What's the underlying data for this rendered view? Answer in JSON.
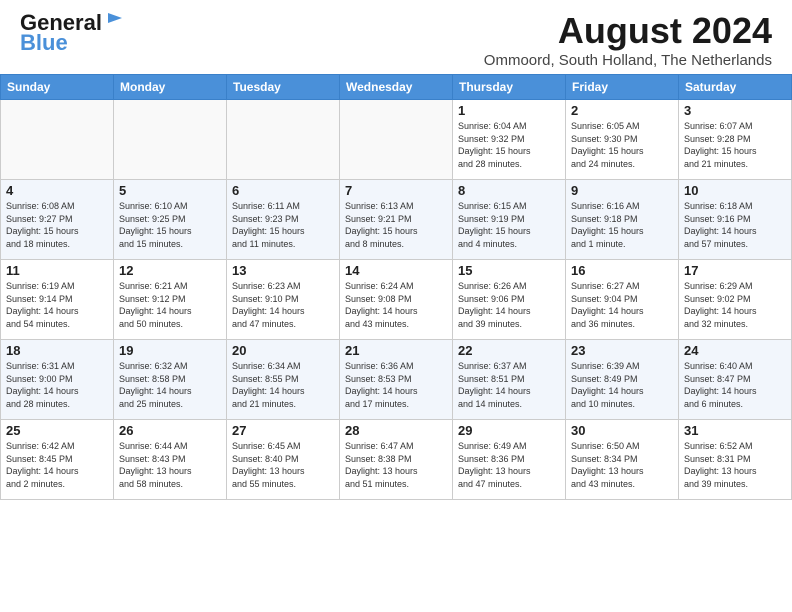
{
  "header": {
    "logo_general": "General",
    "logo_blue": "Blue",
    "month": "August 2024",
    "location": "Ommoord, South Holland, The Netherlands"
  },
  "weekdays": [
    "Sunday",
    "Monday",
    "Tuesday",
    "Wednesday",
    "Thursday",
    "Friday",
    "Saturday"
  ],
  "weeks": [
    [
      {
        "day": "",
        "info": ""
      },
      {
        "day": "",
        "info": ""
      },
      {
        "day": "",
        "info": ""
      },
      {
        "day": "",
        "info": ""
      },
      {
        "day": "1",
        "info": "Sunrise: 6:04 AM\nSunset: 9:32 PM\nDaylight: 15 hours\nand 28 minutes."
      },
      {
        "day": "2",
        "info": "Sunrise: 6:05 AM\nSunset: 9:30 PM\nDaylight: 15 hours\nand 24 minutes."
      },
      {
        "day": "3",
        "info": "Sunrise: 6:07 AM\nSunset: 9:28 PM\nDaylight: 15 hours\nand 21 minutes."
      }
    ],
    [
      {
        "day": "4",
        "info": "Sunrise: 6:08 AM\nSunset: 9:27 PM\nDaylight: 15 hours\nand 18 minutes."
      },
      {
        "day": "5",
        "info": "Sunrise: 6:10 AM\nSunset: 9:25 PM\nDaylight: 15 hours\nand 15 minutes."
      },
      {
        "day": "6",
        "info": "Sunrise: 6:11 AM\nSunset: 9:23 PM\nDaylight: 15 hours\nand 11 minutes."
      },
      {
        "day": "7",
        "info": "Sunrise: 6:13 AM\nSunset: 9:21 PM\nDaylight: 15 hours\nand 8 minutes."
      },
      {
        "day": "8",
        "info": "Sunrise: 6:15 AM\nSunset: 9:19 PM\nDaylight: 15 hours\nand 4 minutes."
      },
      {
        "day": "9",
        "info": "Sunrise: 6:16 AM\nSunset: 9:18 PM\nDaylight: 15 hours\nand 1 minute."
      },
      {
        "day": "10",
        "info": "Sunrise: 6:18 AM\nSunset: 9:16 PM\nDaylight: 14 hours\nand 57 minutes."
      }
    ],
    [
      {
        "day": "11",
        "info": "Sunrise: 6:19 AM\nSunset: 9:14 PM\nDaylight: 14 hours\nand 54 minutes."
      },
      {
        "day": "12",
        "info": "Sunrise: 6:21 AM\nSunset: 9:12 PM\nDaylight: 14 hours\nand 50 minutes."
      },
      {
        "day": "13",
        "info": "Sunrise: 6:23 AM\nSunset: 9:10 PM\nDaylight: 14 hours\nand 47 minutes."
      },
      {
        "day": "14",
        "info": "Sunrise: 6:24 AM\nSunset: 9:08 PM\nDaylight: 14 hours\nand 43 minutes."
      },
      {
        "day": "15",
        "info": "Sunrise: 6:26 AM\nSunset: 9:06 PM\nDaylight: 14 hours\nand 39 minutes."
      },
      {
        "day": "16",
        "info": "Sunrise: 6:27 AM\nSunset: 9:04 PM\nDaylight: 14 hours\nand 36 minutes."
      },
      {
        "day": "17",
        "info": "Sunrise: 6:29 AM\nSunset: 9:02 PM\nDaylight: 14 hours\nand 32 minutes."
      }
    ],
    [
      {
        "day": "18",
        "info": "Sunrise: 6:31 AM\nSunset: 9:00 PM\nDaylight: 14 hours\nand 28 minutes."
      },
      {
        "day": "19",
        "info": "Sunrise: 6:32 AM\nSunset: 8:58 PM\nDaylight: 14 hours\nand 25 minutes."
      },
      {
        "day": "20",
        "info": "Sunrise: 6:34 AM\nSunset: 8:55 PM\nDaylight: 14 hours\nand 21 minutes."
      },
      {
        "day": "21",
        "info": "Sunrise: 6:36 AM\nSunset: 8:53 PM\nDaylight: 14 hours\nand 17 minutes."
      },
      {
        "day": "22",
        "info": "Sunrise: 6:37 AM\nSunset: 8:51 PM\nDaylight: 14 hours\nand 14 minutes."
      },
      {
        "day": "23",
        "info": "Sunrise: 6:39 AM\nSunset: 8:49 PM\nDaylight: 14 hours\nand 10 minutes."
      },
      {
        "day": "24",
        "info": "Sunrise: 6:40 AM\nSunset: 8:47 PM\nDaylight: 14 hours\nand 6 minutes."
      }
    ],
    [
      {
        "day": "25",
        "info": "Sunrise: 6:42 AM\nSunset: 8:45 PM\nDaylight: 14 hours\nand 2 minutes."
      },
      {
        "day": "26",
        "info": "Sunrise: 6:44 AM\nSunset: 8:43 PM\nDaylight: 13 hours\nand 58 minutes."
      },
      {
        "day": "27",
        "info": "Sunrise: 6:45 AM\nSunset: 8:40 PM\nDaylight: 13 hours\nand 55 minutes."
      },
      {
        "day": "28",
        "info": "Sunrise: 6:47 AM\nSunset: 8:38 PM\nDaylight: 13 hours\nand 51 minutes."
      },
      {
        "day": "29",
        "info": "Sunrise: 6:49 AM\nSunset: 8:36 PM\nDaylight: 13 hours\nand 47 minutes."
      },
      {
        "day": "30",
        "info": "Sunrise: 6:50 AM\nSunset: 8:34 PM\nDaylight: 13 hours\nand 43 minutes."
      },
      {
        "day": "31",
        "info": "Sunrise: 6:52 AM\nSunset: 8:31 PM\nDaylight: 13 hours\nand 39 minutes."
      }
    ]
  ]
}
